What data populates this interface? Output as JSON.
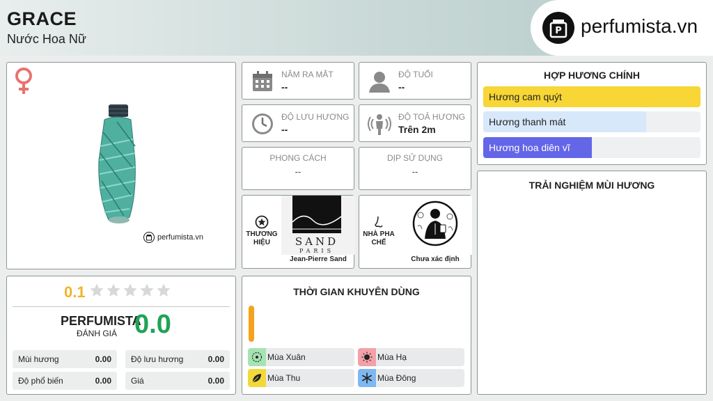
{
  "header": {
    "title": "GRACE",
    "subtitle": "Nước Hoa Nữ",
    "logo_text": "perfumista.vn"
  },
  "product": {
    "gender_icon": "female-icon",
    "image": "perfume-bottle",
    "watermark": "perfumista.vn"
  },
  "info": {
    "release_year": {
      "label": "NĂM RA MẮT",
      "value": "--",
      "icon": "calendar-icon"
    },
    "age": {
      "label": "ĐỘ TUỔI",
      "value": "--",
      "icon": "person-icon"
    },
    "longevity": {
      "label": "ĐỘ LƯU HƯƠNG",
      "value": "--",
      "icon": "clock-icon"
    },
    "sillage": {
      "label": "ĐỘ TOẢ HƯƠNG",
      "value": "Trên 2m",
      "icon": "sillage-icon"
    },
    "style": {
      "label": "PHONG CÁCH",
      "value": "--"
    },
    "occasion": {
      "label": "DỊP SỬ DỤNG",
      "value": "--"
    },
    "brand": {
      "label": "THƯƠNG HIỆU",
      "name": "Jean-Pierre Sand",
      "logo_text": "SAND",
      "logo_sub": "PARIS"
    },
    "perfumer": {
      "label": "NHÀ PHA CHẾ",
      "name": "Chưa xác định"
    }
  },
  "accords": {
    "title": "HỢP HƯƠNG CHÍNH",
    "items": [
      {
        "label": "Hương cam quýt",
        "level": 1.0,
        "color": "#f7d635",
        "text_color": "#222222"
      },
      {
        "label": "Hương thanh mát",
        "level": 0.75,
        "color": "#d8e8fb",
        "text_color": "#222222"
      },
      {
        "label": "Hương hoa diên vĩ",
        "level": 0.5,
        "color": "#6466e8",
        "text_color": "#ffffff"
      }
    ]
  },
  "experience": {
    "title": "TRẢI NGHIỆM MÙI HƯƠNG"
  },
  "rating": {
    "value": "0.1",
    "stars_filled": 0,
    "stars_total": 5,
    "brand": "PERFUMISTA",
    "sub": "ĐÁNH GIÁ",
    "score": "0.0",
    "metrics": [
      {
        "label": "Mùi hương",
        "value": "0.00"
      },
      {
        "label": "Độ lưu hương",
        "value": "0.00"
      },
      {
        "label": "Độ phổ biến",
        "value": "0.00"
      },
      {
        "label": "Giá",
        "value": "0.00"
      }
    ]
  },
  "time_recommend": {
    "title": "THỜI GIAN KHUYÊN DÙNG",
    "seasons": [
      {
        "label": "Mùa Xuân",
        "color": "#a6e3b3",
        "icon": "spring-icon"
      },
      {
        "label": "Mùa Hạ",
        "color": "#f3a1a8",
        "icon": "sun-icon"
      },
      {
        "label": "Mùa Thu",
        "color": "#f2d93a",
        "icon": "leaf-icon"
      },
      {
        "label": "Mùa Đông",
        "color": "#7db8f0",
        "icon": "snowflake-icon"
      }
    ]
  }
}
